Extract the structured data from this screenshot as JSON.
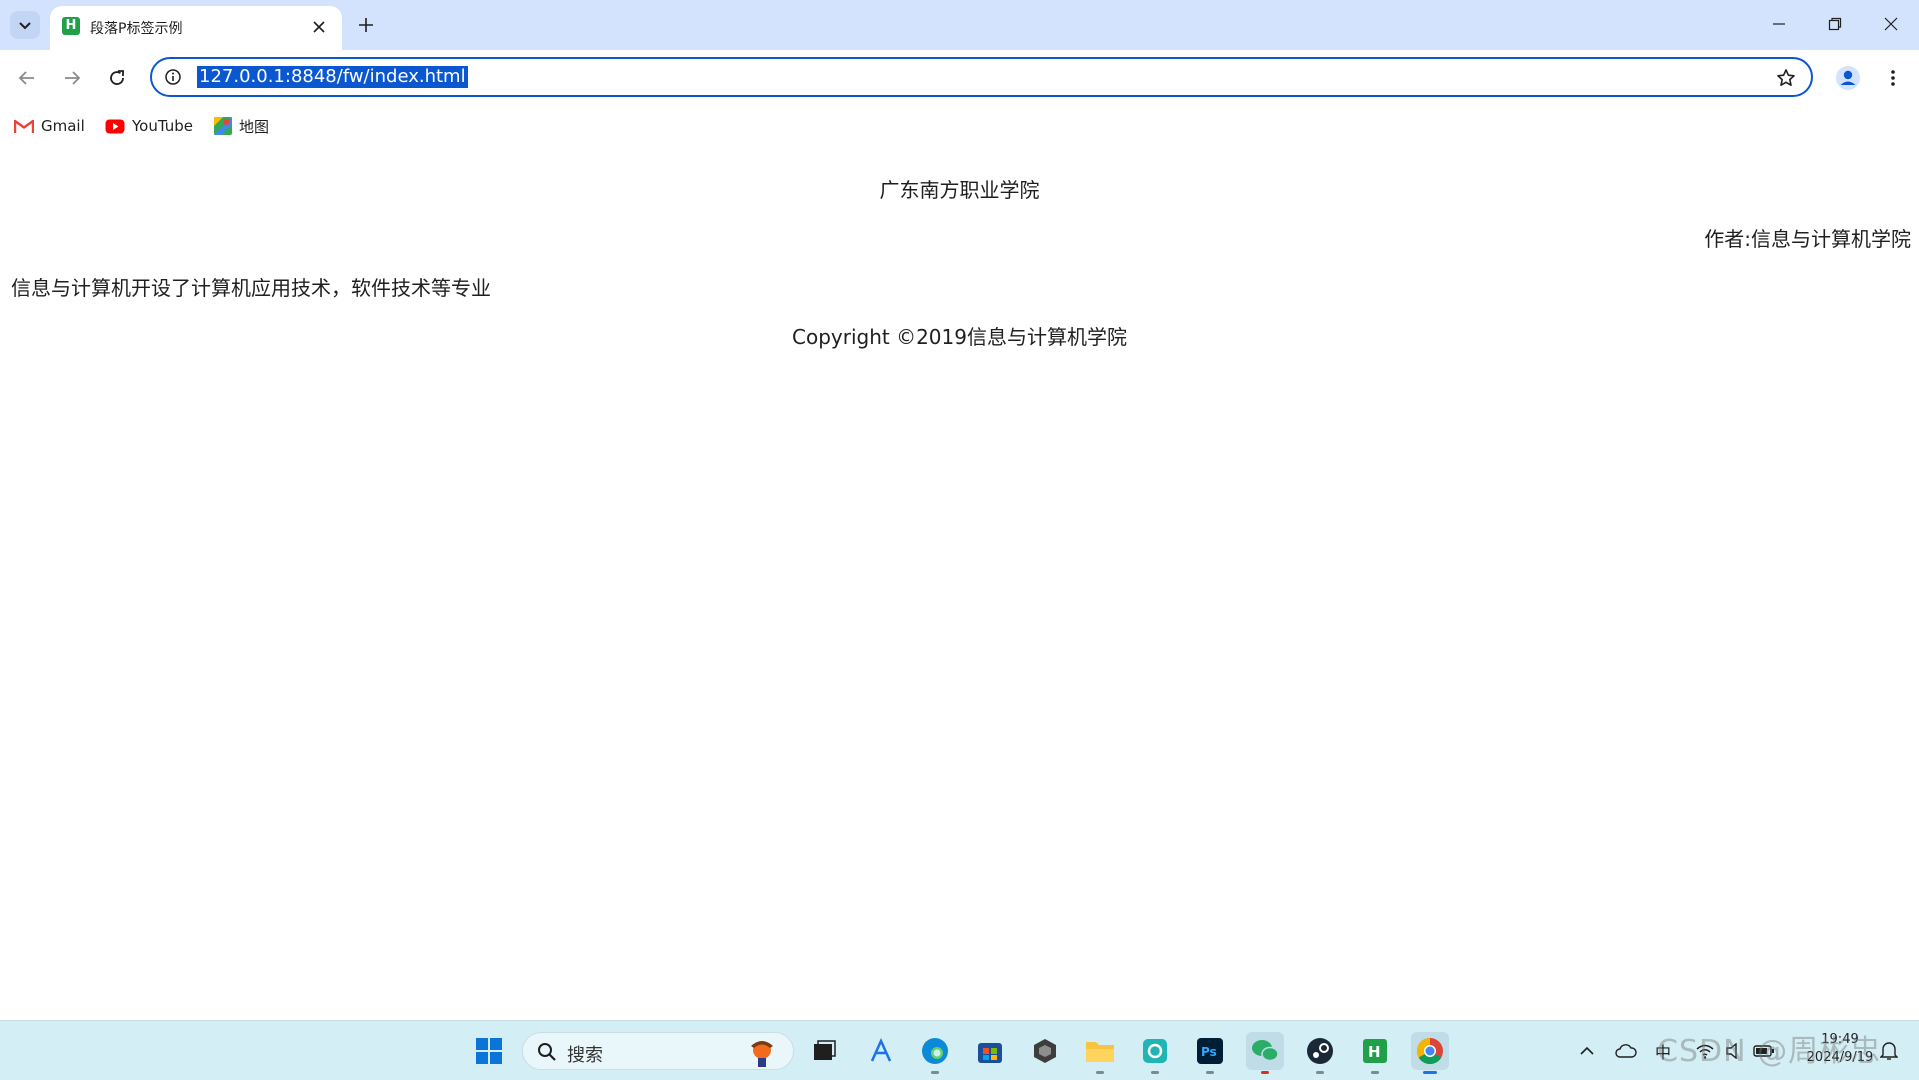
{
  "browser": {
    "tab": {
      "title": "段落P标签示例",
      "favicon_letter": "H"
    },
    "url": "127.0.0.1:8848/fw/index.html",
    "bookmarks": [
      {
        "label": "Gmail",
        "icon": "gmail-icon"
      },
      {
        "label": "YouTube",
        "icon": "youtube-icon"
      },
      {
        "label": "地图",
        "icon": "maps-icon"
      }
    ]
  },
  "page": {
    "title": "广东南方职业学院",
    "author": "作者:信息与计算机学院",
    "body": "信息与计算机开设了计算机应用技术，软件技术等专业",
    "copyright": "Copyright ©2019信息与计算机学院"
  },
  "taskbar": {
    "search_label": "搜索",
    "ime": "中",
    "clock_time": "19:49",
    "clock_date": "2024/9/19",
    "watermark": "CSDN @周彬忠"
  },
  "colors": {
    "tabstrip": "#d3e3fd",
    "accent": "#0b57d0",
    "taskbar": "#d3eef5"
  }
}
